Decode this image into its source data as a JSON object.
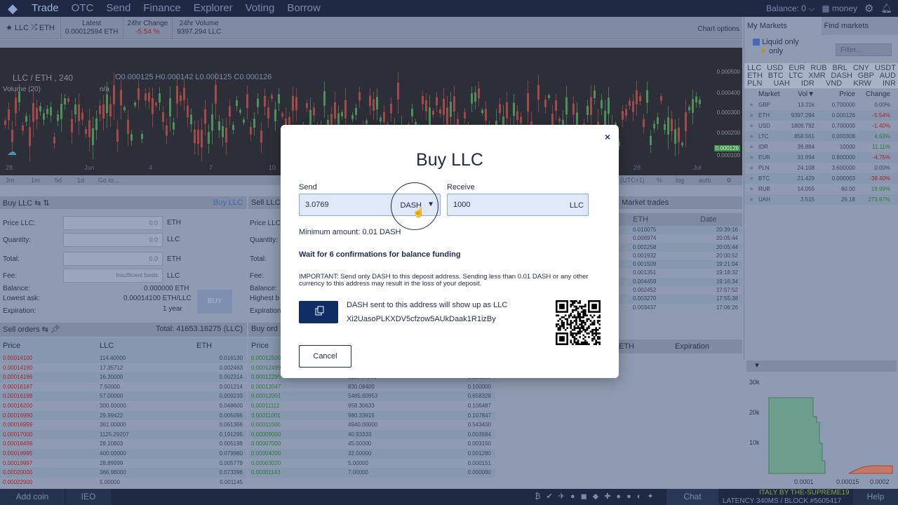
{
  "nav": {
    "items": [
      "Trade",
      "OTC",
      "Send",
      "Finance",
      "Explorer",
      "Voting",
      "Borrow"
    ],
    "balance_label": "Balance:",
    "balance_value": "0",
    "user": "money"
  },
  "market_header": {
    "base": "LLC",
    "quote": "ETH",
    "latest_label": "Latest",
    "latest_value": "0.00012594 ETH",
    "change_label": "24hr Change",
    "change_value": "-5.54 %",
    "volume_label": "24hr Volume",
    "volume_value": "9397.294 LLC",
    "chart_options": "Chart options"
  },
  "chart": {
    "symbol": "LLC / ETH , 240",
    "ohlc": {
      "o_label": "O",
      "o": "0.000125",
      "h_label": "H",
      "h": "0.000142",
      "l_label": "L",
      "l": "0.000125",
      "c_label": "C",
      "c": "0.000126"
    },
    "volume_label": "Volume (20)",
    "volume_value": "n/a",
    "yticks": [
      "0.000500",
      "0.000400",
      "0.000300",
      "0.000200",
      "0.000126",
      "0.000100"
    ],
    "xticks": [
      "28",
      "Jun",
      "4",
      "7",
      "10",
      "28",
      "Jul"
    ],
    "ranges": [
      "3m",
      "1m",
      "5d",
      "1d",
      "Go to..."
    ],
    "right_ctrl": [
      "(UTC+1)",
      "%",
      "log",
      "auto"
    ]
  },
  "right_panel": {
    "tab_my": "My Markets",
    "tab_find": "Find markets",
    "liquid_only": "Liquid only",
    "star_only": "only",
    "filter_placeholder": "Filter...",
    "currencies_row1": [
      "LLC",
      "USD",
      "EUR",
      "RUB",
      "BRL",
      "CNY",
      "USDT"
    ],
    "currencies_row2": [
      "ETH",
      "BTC",
      "LTC",
      "XMR",
      "DASH",
      "GBP",
      "AUD"
    ],
    "currencies_row3": [
      "PLN",
      "UAH",
      "IDR",
      "VND",
      "KRW",
      "INR"
    ],
    "table_headers": [
      "Market",
      "Vol▼",
      "Price",
      "Change"
    ],
    "markets": [
      {
        "name": "GBP",
        "vol": "13.21k",
        "price": "0.700000",
        "change": "0.00%"
      },
      {
        "name": "ETH",
        "vol": "9397.294",
        "price": "0.000126",
        "change": "-5.54%"
      },
      {
        "name": "USD",
        "vol": "1809.792",
        "price": "0.700000",
        "change": "-1.40%"
      },
      {
        "name": "LTC",
        "vol": "858.561",
        "price": "0.000308",
        "change": "4.63%"
      },
      {
        "name": "IDR",
        "vol": "39.884",
        "price": "10000",
        "change": "11.11%"
      },
      {
        "name": "EUR",
        "vol": "31.994",
        "price": "0.800000",
        "change": "-4.75%"
      },
      {
        "name": "PLN",
        "vol": "24.108",
        "price": "3.600000",
        "change": "0.00%"
      },
      {
        "name": "BTC",
        "vol": "21.429",
        "price": "0.000003",
        "change": "-38.40%"
      },
      {
        "name": "RUB",
        "vol": "14.055",
        "price": "60.00",
        "change": "19.99%"
      },
      {
        "name": "UAH",
        "vol": "3.515",
        "price": "26.18",
        "change": "273.97%"
      }
    ],
    "depth_yticks": [
      "30k",
      "20k",
      "10k"
    ],
    "depth_xticks": [
      "0.0001",
      "0.00015",
      "0.0002"
    ]
  },
  "buy_panel": {
    "title": "Buy LLC",
    "link": "Buy LLC",
    "price_label": "Price LLC:",
    "price_value": "0.0",
    "price_unit": "ETH",
    "qty_label": "Quantity:",
    "qty_value": "0.0",
    "qty_unit": "LLC",
    "total_label": "Total:",
    "total_value": "0.0",
    "total_unit": "ETH",
    "fee_label": "Fee:",
    "fee_value": "Insufficient funds",
    "fee_unit": "LLC",
    "balance_label": "Balance:",
    "balance_value": "0.000000 ETH",
    "lowest_label": "Lowest ask:",
    "lowest_value": "0.00014100 ETH/LLC",
    "exp_label": "Expiration:",
    "exp_value": "1 year",
    "buy_btn": "BUY"
  },
  "sell_panel": {
    "title": "Sell LLC",
    "price_label": "Price LLC:",
    "qty_label": "Quantity:",
    "total_label": "Total:",
    "fee_label": "Fee:",
    "balance_label": "Balance:",
    "highest_label": "Highest b",
    "exp_label": "Expiration"
  },
  "sell_orders": {
    "title": "Sell orders",
    "total": "Total: 41653.16275 (LLC)",
    "headers": [
      "Price",
      "LLC",
      "ETH"
    ],
    "rows": [
      [
        "0.00014100",
        "114.40000",
        "0.016130"
      ],
      [
        "0.00014190",
        "17.35712",
        "0.002463"
      ],
      [
        "0.00014196",
        "16.30000",
        "0.002314"
      ],
      [
        "0.00016187",
        "7.50000",
        "0.001214"
      ],
      [
        "0.00016198",
        "57.00000",
        "0.009233"
      ],
      [
        "0.00016200",
        "300.00000",
        "0.048600"
      ],
      [
        "0.00016990",
        "29.99422",
        "0.005096"
      ],
      [
        "0.00016999",
        "361.00000",
        "0.061366"
      ],
      [
        "0.00017000",
        "1125.29207",
        "0.191295"
      ],
      [
        "0.00018496",
        "28.10803",
        "0.005199"
      ],
      [
        "0.00019995",
        "400.00000",
        "0.079980"
      ],
      [
        "0.00019997",
        "28.89999",
        "0.005779"
      ],
      [
        "0.00020000",
        "366.98000",
        "0.073396"
      ],
      [
        "0.00022900",
        "5.00000",
        "0.001145"
      ]
    ]
  },
  "buy_orders": {
    "title": "Buy ord",
    "headers": [
      "Price"
    ],
    "rows": [
      [
        "0.00012500",
        "",
        "0.0"
      ],
      [
        "0.00012499",
        "",
        "0.0"
      ],
      [
        "0.00012295",
        "1116.84000",
        "0.136200"
      ],
      [
        "0.00012047",
        "830.08400",
        "0.100000"
      ],
      [
        "0.00012001",
        "5485.60953",
        "0.658328"
      ],
      [
        "0.00011112",
        "958.30633",
        "0.106487"
      ],
      [
        "0.00011001",
        "980.33815",
        "0.107847"
      ],
      [
        "0.00011000",
        "4940.00000",
        "0.543400"
      ],
      [
        "0.00009000",
        "40.93333",
        "0.003684"
      ],
      [
        "0.00007000",
        "45.00000",
        "0.003150"
      ],
      [
        "0.00004000",
        "32.00000",
        "0.001280"
      ],
      [
        "0.00003020",
        "5.00000",
        "0.000151"
      ],
      [
        "0.00001143",
        "7.00000",
        "0.000080"
      ]
    ]
  },
  "market_trades": {
    "title": "Market trades",
    "headers": [
      "ETH",
      "Date"
    ],
    "rows": [
      [
        "0.010075",
        "20:39:16"
      ],
      [
        "0.006974",
        "20:05:44"
      ],
      [
        "0.002258",
        "20:05:44"
      ],
      [
        "0.001932",
        "20:00:52"
      ],
      [
        "0.001509",
        "19:21:04"
      ],
      [
        "0.001351",
        "19:18:32"
      ],
      [
        "0.004459",
        "19:16:34"
      ],
      [
        "0.002452",
        "17:57:52"
      ],
      [
        "0.003270",
        "17:55:38"
      ],
      [
        "0.003437",
        "17:06:26"
      ]
    ],
    "open_headers": [
      "ETH",
      "Expiration"
    ]
  },
  "bottom": {
    "add_coin": "Add coin",
    "ieo": "IEO",
    "chat": "Chat",
    "help": "Help",
    "credit": "ITALY BY THE-SUPREME19",
    "latency": "LATENCY 340MS / BLOCK #5605417"
  },
  "modal": {
    "title": "Buy LLC",
    "send_label": "Send",
    "send_value": "3.0769",
    "send_currency": "DASH",
    "receive_label": "Receive",
    "receive_value": "1000",
    "receive_currency": "LLC",
    "minimum": "Minimum amount: 0.01 DASH",
    "wait": "Wait for 6 confirmations for balance funding",
    "important": "IMPORTANT: Send only DASH to this deposit address. Sending less than 0.01 DASH or any other currency to this address may result in the loss of your deposit.",
    "address_note": "DASH sent to this address will show up as LLC",
    "address": "Xi2UasoPLKXDV5cfzow5AUkDaak1R1izBy",
    "cancel": "Cancel",
    "close": "×"
  },
  "colors": {
    "accent": "#102d66",
    "nav_bg": "#1e2a44",
    "overlay": "#8f9bb3",
    "negative": "#a8252e",
    "positive": "#2d7a3c"
  }
}
